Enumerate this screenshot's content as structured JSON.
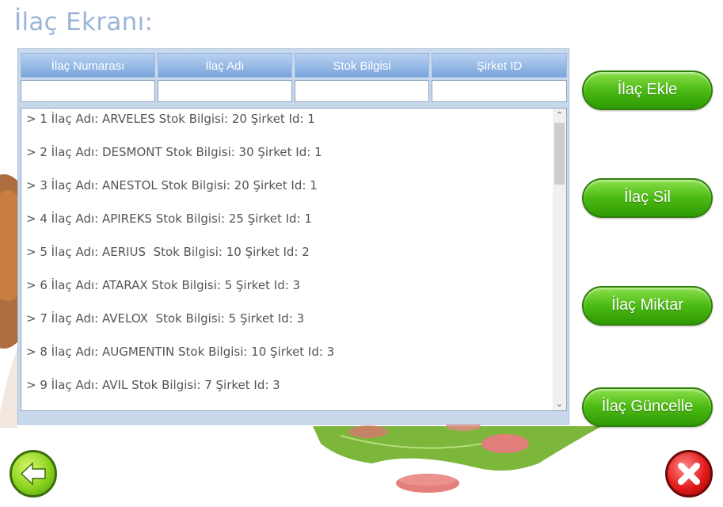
{
  "page": {
    "title": "İlaç Ekranı:"
  },
  "table": {
    "headers": [
      "İlaç Numarası",
      "İlaç Adı",
      "Stok Bilgisi",
      "Şirket ID"
    ],
    "filters": [
      "",
      "",
      "",
      ""
    ]
  },
  "list": {
    "items": [
      "> 1 İlaç Adı: ARVELES Stok Bilgisi: 20 Şirket Id: 1",
      "> 2 İlaç Adı: DESMONT Stok Bilgisi: 30 Şirket Id: 1",
      "> 3 İlaç Adı: ANESTOL Stok Bilgisi: 20 Şirket Id: 1",
      "> 4 İlaç Adı: APIREKS Stok Bilgisi: 25 Şirket Id: 1",
      "> 5 İlaç Adı: AERIUS  Stok Bilgisi: 10 Şirket Id: 2",
      "> 6 İlaç Adı: ATARAX Stok Bilgisi: 5 Şirket Id: 3",
      "> 7 İlaç Adı: AVELOX  Stok Bilgisi: 5 Şirket Id: 3",
      "> 8 İlaç Adı: AUGMENTIN Stok Bilgisi: 10 Şirket Id: 3",
      "> 9 İlaç Adı: AVIL Stok Bilgisi: 7 Şirket Id: 3"
    ]
  },
  "actions": {
    "add_label": "İlaç Ekle",
    "delete_label": "İlaç Sil",
    "quantity_label": "İlaç Miktar",
    "update_label": "İlaç Güncelle"
  },
  "icons": {
    "back": "left-arrow-icon",
    "close": "close-x-icon",
    "scroll_up": "chevron-up-icon",
    "scroll_down": "chevron-down-icon"
  },
  "colors": {
    "title": "#9bb5d6",
    "header_blue": "#7aa5dc",
    "button_green": "#4cba13",
    "close_red": "#e41b1b"
  }
}
